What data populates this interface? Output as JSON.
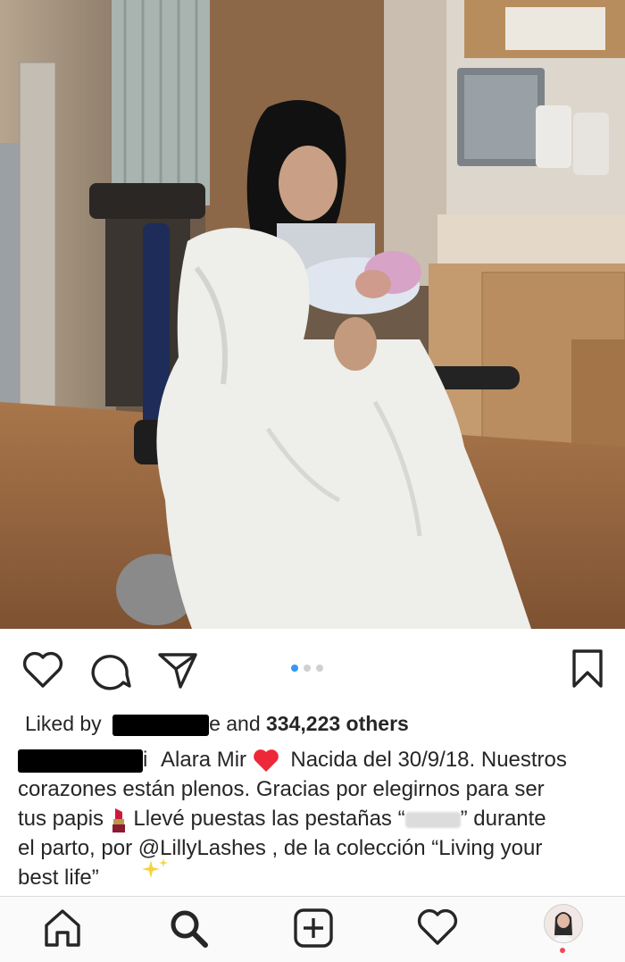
{
  "post": {
    "image_icon": "hospital-newborn-photo",
    "carousel": {
      "total": 3,
      "active_index": 0
    }
  },
  "actions": {
    "like_icon": "heart-outline-icon",
    "comment_icon": "speech-bubble-icon",
    "share_icon": "paper-plane-icon",
    "save_icon": "bookmark-icon"
  },
  "likes": {
    "prefix": "Liked by",
    "name_suffix": "e",
    "and": "and",
    "count": "334,223 others"
  },
  "caption": {
    "line1_user_tail": "i",
    "line1_name": "Alara Mir",
    "line1_text": "Nacida del 30/9/18. Nuestros",
    "line2": "corazones están plenos. Gracias por elegirnos para ser",
    "line3_a": "tus papis",
    "line3_b": "Llevé puestas las pestañas “",
    "line3_c": "” durante",
    "line4": "el parto, por @LillyLashes , de la colección “Living your",
    "line5": "best life”"
  },
  "nav": {
    "home_icon": "home-icon",
    "search_icon": "search-icon",
    "add_icon": "add-post-icon",
    "activity_icon": "heart-icon",
    "profile_icon": "profile-avatar"
  },
  "colors": {
    "active_dot": "#3897f0",
    "notification": "#ed4956",
    "heart_emoji": "#ed2939"
  }
}
